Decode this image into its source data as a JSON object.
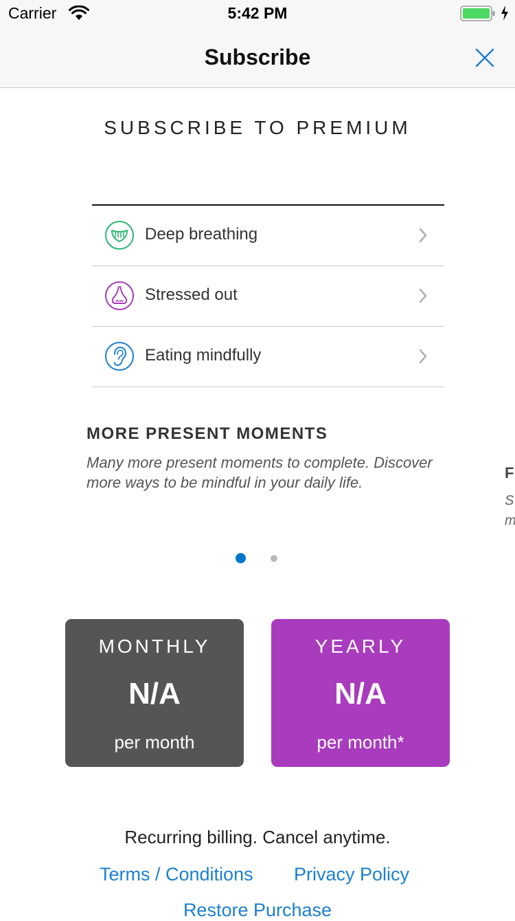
{
  "status_bar": {
    "carrier": "Carrier",
    "time": "5:42 PM"
  },
  "nav": {
    "title": "Subscribe",
    "close_icon": "close-icon"
  },
  "heading": "SUBSCRIBE TO PREMIUM",
  "moments": [
    {
      "label": "Deep breathing",
      "icon": "mouth-icon",
      "color": "#2bb673"
    },
    {
      "label": "Stressed out",
      "icon": "nose-icon",
      "color": "#a93bbd"
    },
    {
      "label": "Eating mindfully",
      "icon": "ear-icon",
      "color": "#1c7fd0"
    }
  ],
  "carousel": {
    "title": "MORE PRESENT MOMENTS",
    "description": "Many more present moments to complete. Discover more ways to be mindful in your daily life.",
    "peek_title": "F",
    "peek_desc_1": "S",
    "peek_desc_2": "m",
    "page_count": 2,
    "active_page": 1,
    "active_color": "#0077cc"
  },
  "plans": {
    "monthly": {
      "name": "MONTHLY",
      "price": "N/A",
      "period": "per month",
      "color": "#555555"
    },
    "yearly": {
      "name": "YEARLY",
      "price": "N/A",
      "period": "per month*",
      "color": "#a93bbd"
    }
  },
  "footer": {
    "billing": "Recurring billing. Cancel anytime.",
    "terms": "Terms / Conditions",
    "privacy": "Privacy Policy",
    "restore": "Restore Purchase"
  }
}
